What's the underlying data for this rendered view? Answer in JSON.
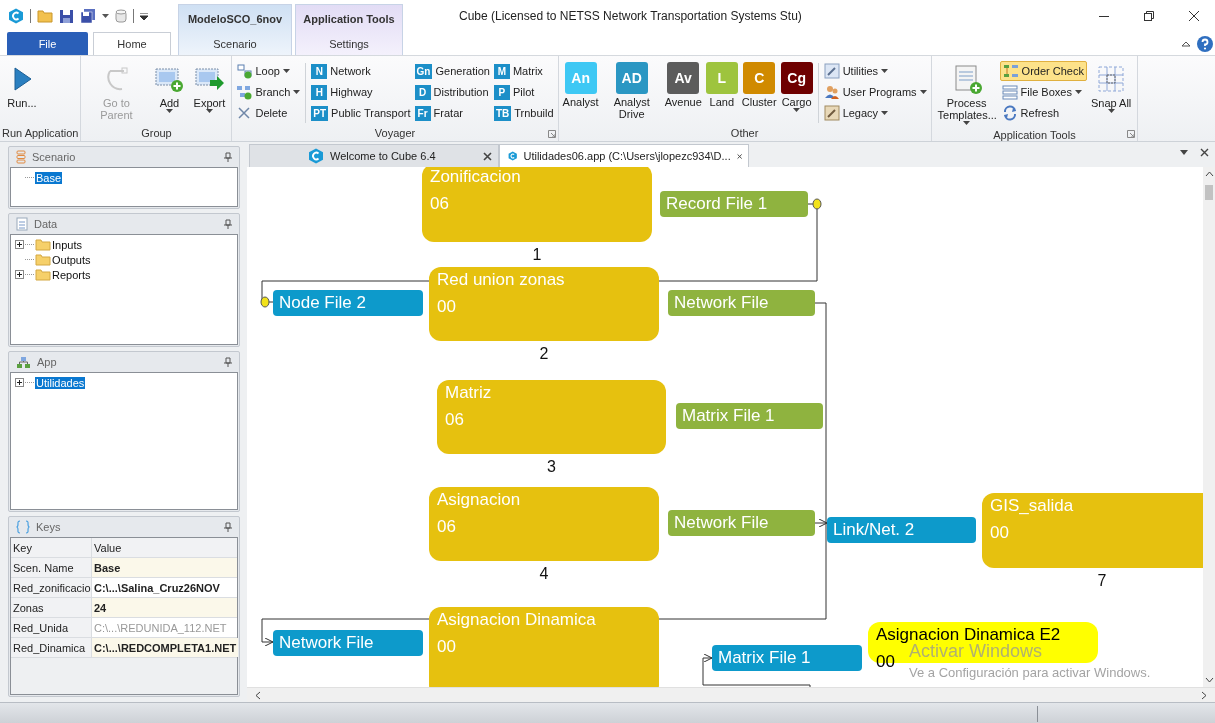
{
  "window": {
    "title": "Cube (Licensed to NETSS Network Transportation Systems Stu)"
  },
  "ribbon_tabs": [
    {
      "label": "File",
      "kind": "file",
      "selected": false
    },
    {
      "label": "Home",
      "kind": "tab",
      "selected": true
    },
    {
      "label": "Scenario",
      "kind": "context",
      "context_title": "ModeloSCO_6nov",
      "selected": false
    },
    {
      "label": "Settings",
      "kind": "context",
      "context_title": "Application Tools",
      "selected": false
    }
  ],
  "ribbon": {
    "groups": [
      {
        "title": "Run Application",
        "launcher": false,
        "items": [
          {
            "kind": "large",
            "label": "Run...",
            "disabled": false,
            "dropdown": false
          }
        ]
      },
      {
        "title": "Group",
        "launcher": false,
        "items": [
          {
            "kind": "large",
            "label": "Go to Parent",
            "disabled": true,
            "dropdown": false
          },
          {
            "kind": "large",
            "label": "Add",
            "disabled": false,
            "dropdown": true
          },
          {
            "kind": "large",
            "label": "Export",
            "disabled": false,
            "dropdown": true
          }
        ]
      },
      {
        "title": "Voyager",
        "launcher": true,
        "items": [
          {
            "kind": "tool",
            "label": "Loop",
            "dropdown": true
          },
          {
            "kind": "tool",
            "label": "Branch",
            "dropdown": true
          },
          {
            "kind": "tool",
            "label": "Delete",
            "dropdown": false
          },
          {
            "kind": "badge",
            "badge": "N",
            "label": "Network"
          },
          {
            "kind": "badge",
            "badge": "H",
            "label": "Highway"
          },
          {
            "kind": "badge",
            "badge": "PT",
            "label": "Public Transport"
          },
          {
            "kind": "badge",
            "badge": "Gn",
            "label": "Generation"
          },
          {
            "kind": "badge",
            "badge": "D",
            "label": "Distribution"
          },
          {
            "kind": "badge",
            "badge": "Fr",
            "label": "Fratar"
          },
          {
            "kind": "badge",
            "badge": "M",
            "label": "Matrix"
          },
          {
            "kind": "badge",
            "badge": "P",
            "label": "Pilot"
          },
          {
            "kind": "badge",
            "badge": "TB",
            "label": "Trnbuild"
          }
        ]
      },
      {
        "title": "Other",
        "launcher": false,
        "items": [
          {
            "kind": "tile",
            "badge": "An",
            "label": "Analyst",
            "color": "#3ec8f4",
            "dropdown": false
          },
          {
            "kind": "tile",
            "badge": "AD",
            "label": "Analyst Drive",
            "color": "#2b97c3",
            "dropdown": false
          },
          {
            "kind": "tile",
            "badge": "Av",
            "label": "Avenue",
            "color": "#5c5c5c",
            "dropdown": false
          },
          {
            "kind": "tile",
            "badge": "L",
            "label": "Land",
            "color": "#9ec43e",
            "dropdown": false
          },
          {
            "kind": "tile",
            "badge": "C",
            "label": "Cluster",
            "color": "#d08a00",
            "dropdown": false
          },
          {
            "kind": "tile",
            "badge": "Cg",
            "label": "Cargo",
            "color": "#6e0000",
            "dropdown": true
          },
          {
            "kind": "tool",
            "label": "Utilities",
            "dropdown": true
          },
          {
            "kind": "tool",
            "label": "User Programs",
            "dropdown": true
          },
          {
            "kind": "tool",
            "label": "Legacy",
            "dropdown": true
          }
        ]
      },
      {
        "title": "Application Tools",
        "launcher": true,
        "items": [
          {
            "kind": "large",
            "label": "Process Templates...",
            "disabled": false,
            "dropdown": true
          },
          {
            "kind": "tool",
            "label": "Order Check",
            "dropdown": false,
            "on": true
          },
          {
            "kind": "tool",
            "label": "File Boxes",
            "dropdown": true
          },
          {
            "kind": "tool",
            "label": "Refresh",
            "dropdown": false
          },
          {
            "kind": "large",
            "label": "Snap All",
            "disabled": false,
            "dropdown": true
          }
        ]
      }
    ]
  },
  "panels": [
    {
      "title": "Scenario",
      "tree": [
        {
          "label": "Base",
          "selected": true,
          "expandable": false
        }
      ]
    },
    {
      "title": "Data",
      "tree": [
        {
          "label": "Inputs",
          "selected": false,
          "expandable": true
        },
        {
          "label": "Outputs",
          "selected": false,
          "expandable": false
        },
        {
          "label": "Reports",
          "selected": false,
          "expandable": true
        }
      ]
    },
    {
      "title": "App",
      "tree": [
        {
          "label": "Utilidades",
          "selected": true,
          "expandable": true
        }
      ]
    }
  ],
  "keys": {
    "title": "Keys",
    "columns": [
      "Key",
      "Value"
    ],
    "rows": [
      {
        "key": "Scen. Name",
        "value": "Base",
        "disabled": false
      },
      {
        "key": "Red_zonificacio",
        "value": "C:\\...\\Salina_Cruz26NOV",
        "disabled": false
      },
      {
        "key": "Zonas",
        "value": "24",
        "disabled": false
      },
      {
        "key": "Red_Unida",
        "value": "C:\\...\\REDUNIDA_112.NET",
        "disabled": true
      },
      {
        "key": "Red_Dinamica",
        "value": "C:\\...\\REDCOMPLETA1.NET",
        "disabled": false
      }
    ]
  },
  "doc_tabs": [
    {
      "label": "Welcome to Cube 6.4",
      "selected": false
    },
    {
      "label": "Utilidades06.app (C:\\Users\\jlopezc934\\D...",
      "selected": true
    }
  ],
  "canvas": {
    "nodes": [
      {
        "kind": "process",
        "title": "Zonificacion",
        "code": "06",
        "order": "1",
        "color": "#e6c10f"
      },
      {
        "kind": "file",
        "label": "Record File 1",
        "color": "#8fb33f"
      },
      {
        "kind": "file",
        "label": "Node File 2",
        "color": "#0d9acb"
      },
      {
        "kind": "process",
        "title": "Red union zonas",
        "code": "00",
        "order": "2",
        "color": "#e6c10f"
      },
      {
        "kind": "file",
        "label": "Network File",
        "color": "#8fb33f"
      },
      {
        "kind": "process",
        "title": "Matriz",
        "code": "06",
        "order": "3",
        "color": "#e6c10f"
      },
      {
        "kind": "file",
        "label": "Matrix File 1",
        "color": "#8fb33f"
      },
      {
        "kind": "process",
        "title": "Asignacion",
        "code": "06",
        "order": "4",
        "color": "#e6c10f"
      },
      {
        "kind": "file",
        "label": "Network File",
        "color": "#8fb33f"
      },
      {
        "kind": "file",
        "label": "Link/Net. 2",
        "color": "#0d9acb"
      },
      {
        "kind": "process",
        "title": "GIS_salida",
        "code": "00",
        "order": "7",
        "color": "#e6c10f"
      },
      {
        "kind": "file",
        "label": "Network File",
        "color": "#0d9acb"
      },
      {
        "kind": "process",
        "title": "Asignacion Dinamica",
        "code": "00",
        "color": "#e6c10f"
      },
      {
        "kind": "file",
        "label": "Matrix File 1",
        "color": "#0d9acb"
      },
      {
        "kind": "process",
        "title": "Asignacion Dinamica E2",
        "code": "00",
        "color": "#ffff00"
      }
    ]
  },
  "activation_notice": {
    "title": "Activar Windows",
    "subtitle": "Ve a Configuración para activar Windows."
  }
}
